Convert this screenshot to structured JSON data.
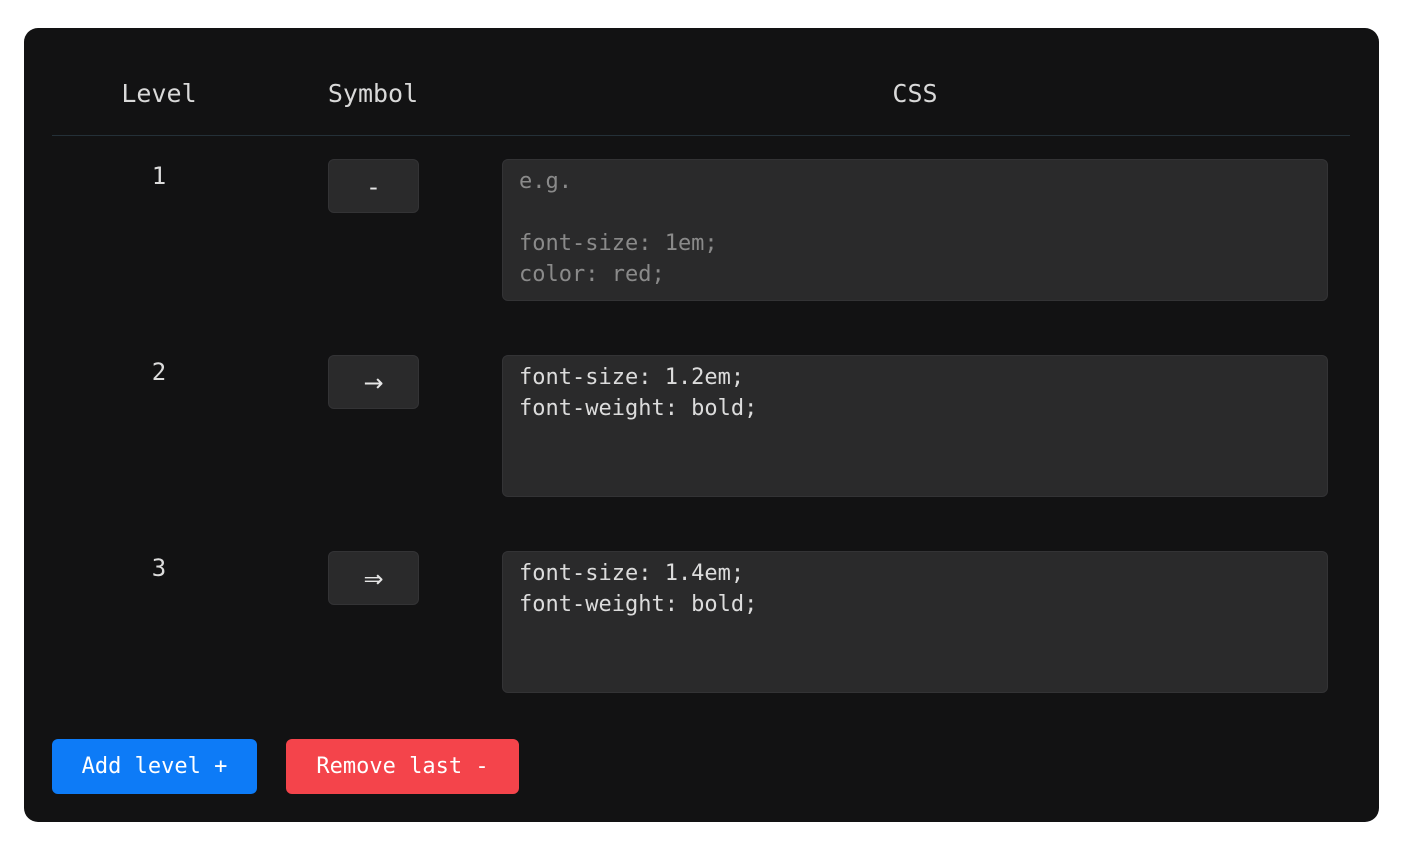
{
  "table": {
    "headers": {
      "level": "Level",
      "symbol": "Symbol",
      "css": "CSS"
    },
    "rows": [
      {
        "level": "1",
        "symbol": "-",
        "css": "",
        "css_placeholder": "e.g.\n\nfont-size: 1em;\ncolor: red;"
      },
      {
        "level": "2",
        "symbol": "→",
        "css": "font-size: 1.2em;\nfont-weight: bold;"
      },
      {
        "level": "3",
        "symbol": "⇒",
        "css": "font-size: 1.4em;\nfont-weight: bold;"
      }
    ]
  },
  "actions": {
    "add_label": "Add level +",
    "remove_label": "Remove last -"
  },
  "colors": {
    "panel_bg": "#121213",
    "input_bg": "#2a2a2b",
    "add_button": "#0d7bf7",
    "remove_button": "#f4444b"
  }
}
